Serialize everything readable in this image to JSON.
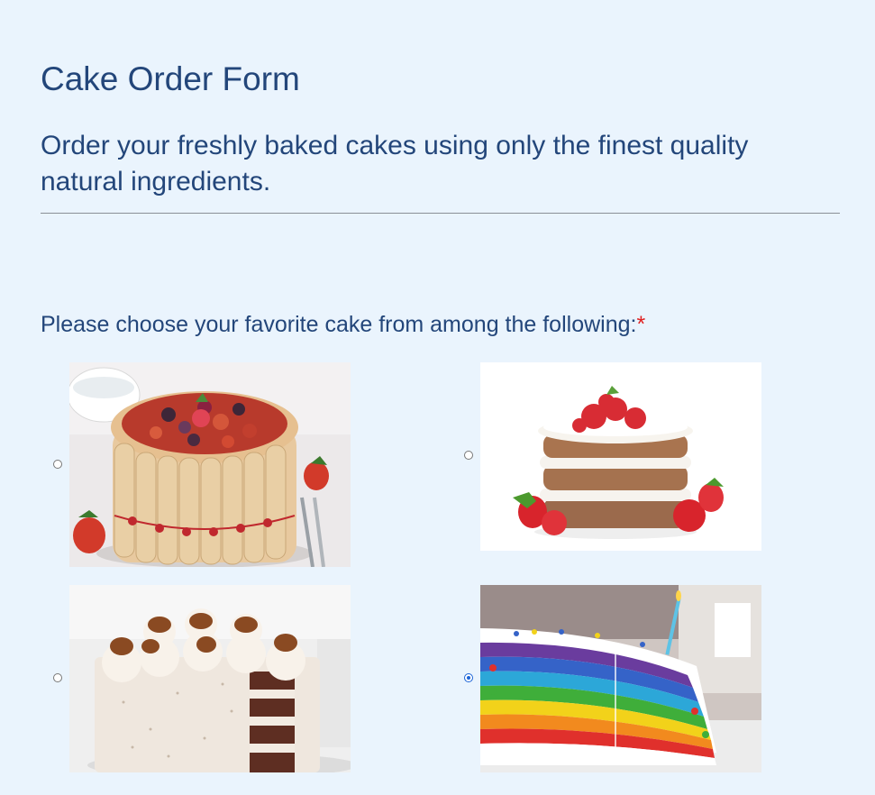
{
  "form": {
    "title": "Cake Order Form",
    "subtitle": "Order your freshly baked cakes using only the finest quality natural ingredients.",
    "question": "Please choose your favorite cake from among the following:",
    "required_marker": "*"
  },
  "cake_options": [
    {
      "image": "berry-charlotte-cake-photo",
      "selected": false
    },
    {
      "image": "strawberry-naked-layer-cake-photo",
      "selected": false
    },
    {
      "image": "cream-caramel-layer-cake-photo",
      "selected": false
    },
    {
      "image": "rainbow-layer-cake-photo",
      "selected": true
    }
  ],
  "colors": {
    "background": "#eaf4fd",
    "heading": "#23467a",
    "required": "#e02020",
    "radio_selected": "#1a63d6"
  }
}
